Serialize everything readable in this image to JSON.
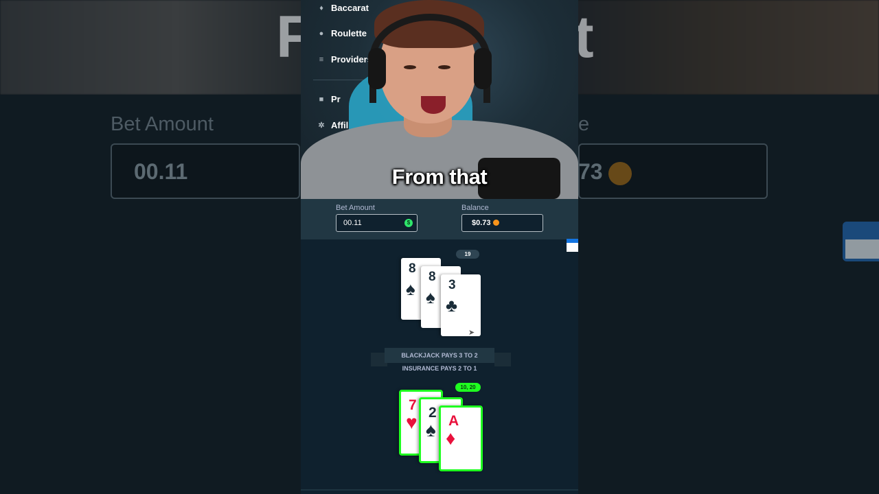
{
  "background": {
    "left_label": "Bet Amount",
    "left_value": "00.11",
    "right_value": "73"
  },
  "sidebar_menu": [
    {
      "label": "Baccarat",
      "icon": "cards-icon"
    },
    {
      "label": "Roulette",
      "icon": "roulette-icon"
    },
    {
      "label": "Providers",
      "icon": "stack-icon"
    },
    {
      "label": "Pr",
      "icon": "gift-icon"
    },
    {
      "label": "Affil",
      "icon": "network-icon"
    }
  ],
  "caption": "From that",
  "bet": {
    "bet_label": "Bet Amount",
    "bet_value": "00.11",
    "bet_currency_symbol": "$",
    "balance_label": "Balance",
    "balance_value": "$0.73"
  },
  "dealer": {
    "total": "19",
    "cards": [
      {
        "rank": "8",
        "suit": "♠",
        "color": "black"
      },
      {
        "rank": "8",
        "suit": "♠",
        "color": "black"
      },
      {
        "rank": "3",
        "suit": "♣",
        "color": "black"
      }
    ]
  },
  "table_text": {
    "blackjack": "BLACKJACK PAYS 3 TO 2",
    "insurance": "INSURANCE PAYS 2 TO 1"
  },
  "player": {
    "total": "10, 20",
    "cards": [
      {
        "rank": "7",
        "suit": "♥",
        "color": "red"
      },
      {
        "rank": "2",
        "suit": "♠",
        "color": "black"
      },
      {
        "rank": "A",
        "suit": "♦",
        "color": "red"
      }
    ]
  },
  "colors": {
    "win_border": "#1fff20",
    "panel": "#213743",
    "table": "#0f212e",
    "red_suit": "#e9113c"
  }
}
